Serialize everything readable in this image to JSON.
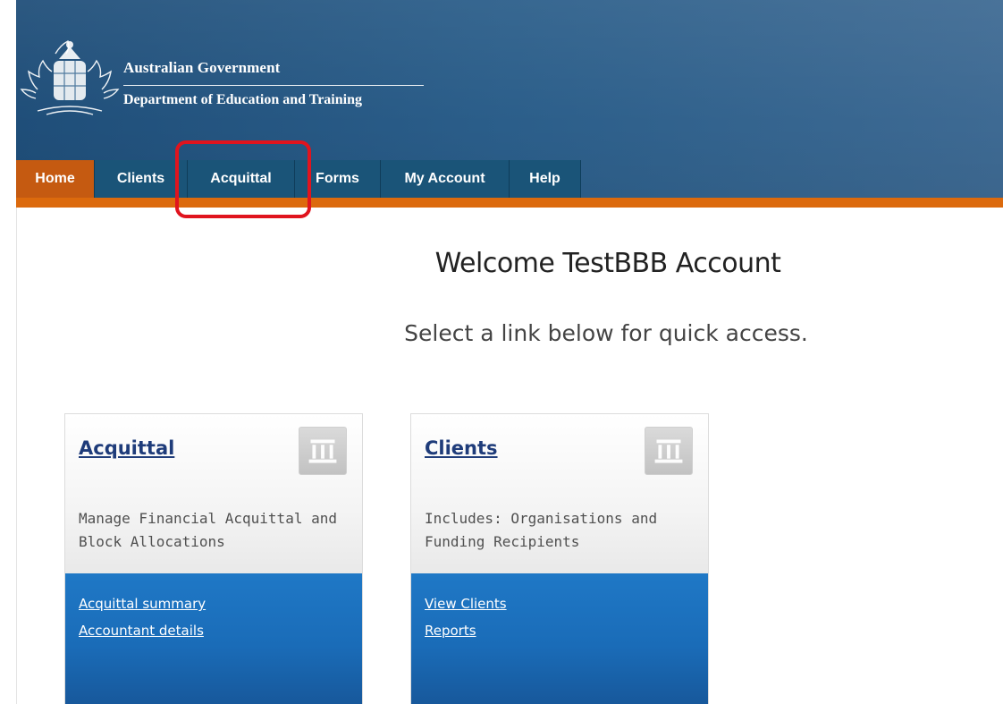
{
  "header": {
    "gov_title": "Australian Government",
    "department": "Department of Education and Training",
    "crest_icon": "coat-of-arms-icon",
    "background_color": "#2b5e8a"
  },
  "nav": {
    "tabs": [
      {
        "label": "Home",
        "active": true
      },
      {
        "label": "Clients",
        "active": false
      },
      {
        "label": "Acquittal",
        "active": false
      },
      {
        "label": "Forms",
        "active": false
      },
      {
        "label": "My Account",
        "active": false
      },
      {
        "label": "Help",
        "active": false
      }
    ],
    "active_color": "#c55a11",
    "tab_color": "#1a5478",
    "strip_color": "#dc6a0d"
  },
  "highlight": {
    "color": "#e0141e",
    "target": "Acquittal"
  },
  "main": {
    "welcome": "Welcome TestBBB Account",
    "subtitle": "Select a link below for quick access."
  },
  "cards": [
    {
      "title": "Acquittal",
      "icon": "building-icon",
      "description_lines": [
        "Manage Financial Acquittal and",
        "Block Allocations"
      ],
      "links": [
        "Acquittal summary",
        "Accountant details"
      ]
    },
    {
      "title": "Clients",
      "icon": "building-icon",
      "description_lines": [
        "Includes: Organisations and",
        "Funding Recipients"
      ],
      "links": [
        "View Clients",
        "Reports"
      ]
    }
  ]
}
